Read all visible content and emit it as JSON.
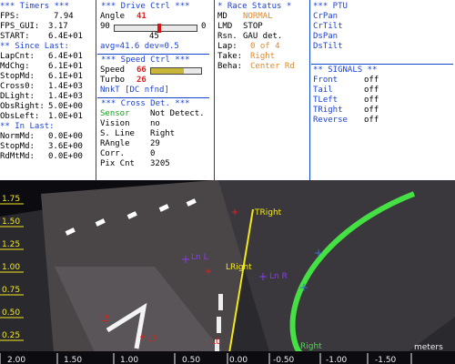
{
  "timers": {
    "header": "*** Timers ***",
    "fps": {
      "label": "FPS:",
      "value": "7.94"
    },
    "fps_gui": {
      "label": "FPS_GUI:",
      "value": "3.17"
    },
    "start": {
      "label": "START:",
      "value": "6.4E+01"
    },
    "since_header": "** Since Last:",
    "lapcnt": {
      "label": "LapCnt:",
      "value": "6.4E+01"
    },
    "mdchg": {
      "label": "MdChg:",
      "value": "6.1E+01"
    },
    "stopmd": {
      "label": "StopMd:",
      "value": "6.1E+01"
    },
    "cross0": {
      "label": "Cross0:",
      "value": "1.4E+03"
    },
    "dlight": {
      "label": "DLight:",
      "value": "1.4E+03"
    },
    "obsright": {
      "label": "ObsRight:",
      "value": "5.0E+00"
    },
    "obsleft": {
      "label": "ObsLeft:",
      "value": "1.0E+01"
    },
    "inlast_header": "** In Last:",
    "normmd": {
      "label": "NormMd:",
      "value": "0.0E+00"
    },
    "stopmd2": {
      "label": "StopMd:",
      "value": "3.6E+00"
    },
    "rdmtmd": {
      "label": "RdMtMd:",
      "value": "0.0E+00"
    }
  },
  "drive": {
    "header": "***  Drive Ctrl  ***",
    "angle_label": "Angle",
    "angle_value": "41",
    "angle_min": "90",
    "angle_max": "0",
    "angle_level": 0.54,
    "angle_center": "45",
    "avg": "avg=41.6  dev=0.5",
    "speed_header": "***  Speed Ctrl  ***",
    "speed_label": "Speed",
    "speed_value": "66",
    "speed_level": 0.66,
    "turbo_label": "Turbo",
    "turbo_value": "26",
    "nnkt": "NnkT [DC nfnd]",
    "cross_header": "*** Cross Det. ***",
    "sensor_label": "Sensor",
    "sensor_value": "Not Detect.",
    "vision_label": "Vision",
    "vision_value": "no",
    "sline_label": "S. Line",
    "sline_value": "Right",
    "rangle_label": "RAngle",
    "rangle_value": "29",
    "corr_label": "Corr.",
    "corr_value": "0",
    "pix_label": "Pix Cnt",
    "pix_value": "3205"
  },
  "race": {
    "header": "* Race Status *",
    "md_label": "MD",
    "md_value": "NORMAL",
    "lmd_label": "LMD",
    "lmd_value": "STOP",
    "rsn_label": "Rsn.",
    "rsn_value": "GAU det.",
    "lap_label": "Lap:",
    "lap_value": "0 of 4",
    "take_label": "Take:",
    "take_value": "Right",
    "beha_label": "Beha:",
    "beha_value": "Center Rd"
  },
  "ptu": {
    "header": "*** PTU",
    "items": [
      "CrPan",
      "CrTilt",
      "DsPan",
      "DsTilt"
    ],
    "signals_header": "** SIGNALS **",
    "signals": [
      {
        "label": "Front",
        "value": "off"
      },
      {
        "label": "Tail",
        "value": "off"
      },
      {
        "label": "TLeft",
        "value": "off"
      },
      {
        "label": "TRight",
        "value": "off"
      },
      {
        "label": "Reverse",
        "value": "off"
      }
    ]
  },
  "camera": {
    "left_axis": [
      "1.75",
      "1.50",
      "1.25",
      "1.00",
      "0.75",
      "0.50",
      "0.25"
    ],
    "bottom_axis": [
      "2.00",
      "1.50",
      "1.00",
      "0.50",
      "0.00",
      "-0.50",
      "-1.00",
      "-1.50"
    ],
    "unit_label": "meters",
    "annotations": {
      "tright": "TRight",
      "lright": "LRight",
      "ll1": "Ln L",
      "ll2": "Ln R",
      "l5": "L5",
      "l7": "L7",
      "r0": "L0",
      "right_bottom": "Right"
    },
    "colors": {
      "yellow": "#f2e81e",
      "green": "#44e044",
      "purple": "#8a3cf0",
      "red": "#e02020"
    }
  }
}
